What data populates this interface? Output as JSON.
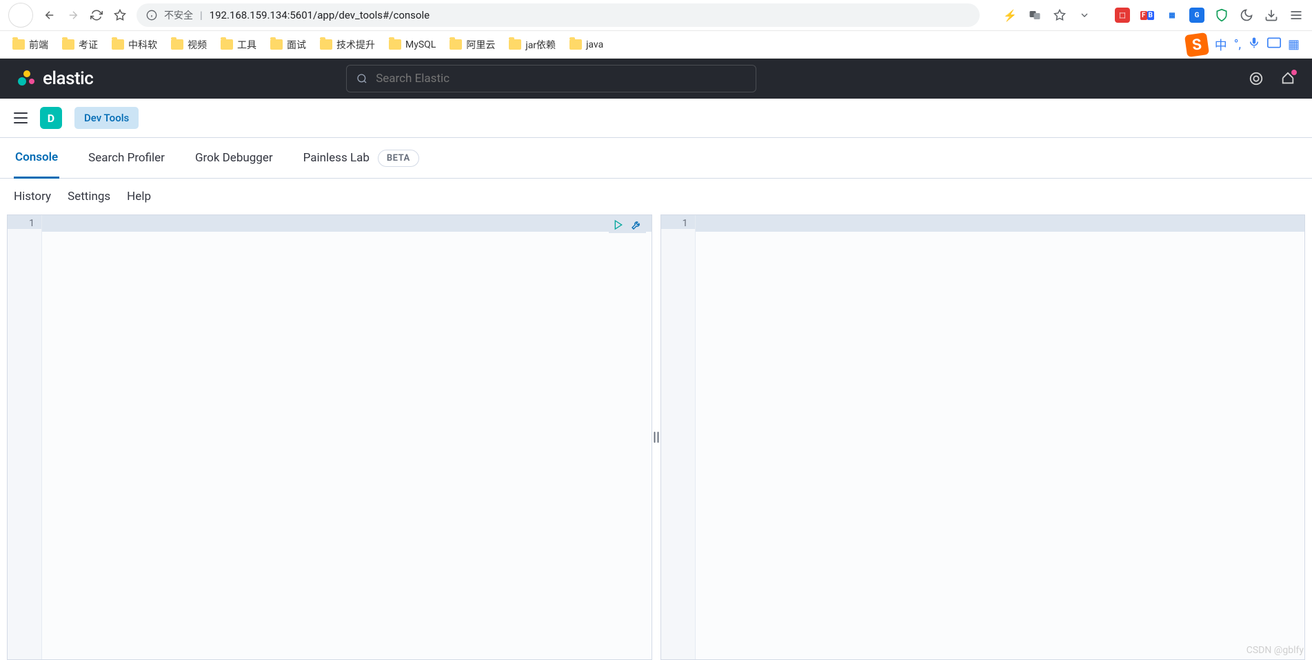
{
  "browser": {
    "url_insecure_label": "不安全",
    "url": "192.168.159.134:5601/app/dev_tools#/console",
    "bookmarks": [
      "前端",
      "考证",
      "中科软",
      "视频",
      "工具",
      "面试",
      "技术提升",
      "MySQL",
      "阿里云",
      "jar依赖",
      "java"
    ]
  },
  "elastic": {
    "brand": "elastic",
    "search_placeholder": "Search Elastic",
    "space_letter": "D",
    "dev_chip": "Dev Tools"
  },
  "tabs": {
    "console": "Console",
    "search_profiler": "Search Profiler",
    "grok": "Grok Debugger",
    "painless": "Painless Lab",
    "beta": "BETA"
  },
  "toolbar": {
    "history": "History",
    "settings": "Settings",
    "help": "Help"
  },
  "editor": {
    "left_line": "1",
    "right_line": "1"
  },
  "watermark": "CSDN @gblfy"
}
